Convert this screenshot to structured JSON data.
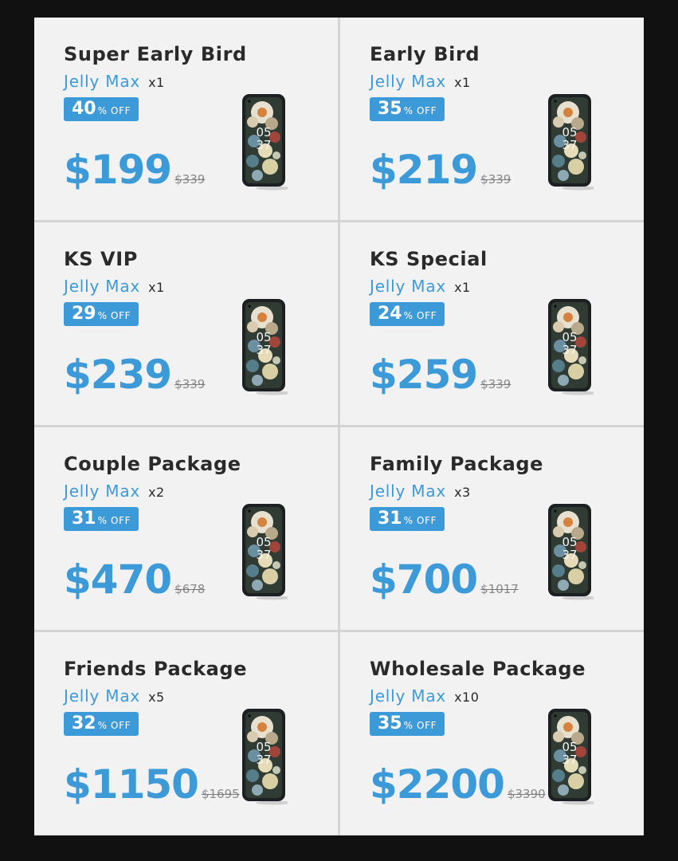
{
  "packages": [
    {
      "title": "Super Early Bird",
      "brand": "Jelly Max",
      "qty": "x1",
      "discount": "40",
      "off": "% OFF",
      "price": "$199",
      "original": "$339",
      "clock": "05 37"
    },
    {
      "title": "Early Bird",
      "brand": "Jelly Max",
      "qty": "x1",
      "discount": "35",
      "off": "% OFF",
      "price": "$219",
      "original": "$339",
      "clock": "05 37"
    },
    {
      "title": "KS VIP",
      "brand": "Jelly Max",
      "qty": "x1",
      "discount": "29",
      "off": "% OFF",
      "price": "$239",
      "original": "$339",
      "clock": "05 37"
    },
    {
      "title": "KS Special",
      "brand": "Jelly Max",
      "qty": "x1",
      "discount": "24",
      "off": "% OFF",
      "price": "$259",
      "original": "$339",
      "clock": "05 37"
    },
    {
      "title": "Couple Package",
      "brand": "Jelly Max",
      "qty": "x2",
      "discount": "31",
      "off": "% OFF",
      "price": "$470",
      "original": "$678",
      "clock": "05 37"
    },
    {
      "title": "Family Package",
      "brand": "Jelly Max",
      "qty": "x3",
      "discount": "31",
      "off": "% OFF",
      "price": "$700",
      "original": "$1017",
      "clock": "05 37"
    },
    {
      "title": "Friends Package",
      "brand": "Jelly Max",
      "qty": "x5",
      "discount": "32",
      "off": "% OFF",
      "price": "$1150",
      "original": "$1695",
      "clock": "05 37"
    },
    {
      "title": "Wholesale Package",
      "brand": "Jelly Max",
      "qty": "x10",
      "discount": "35",
      "off": "% OFF",
      "price": "$2200",
      "original": "$3390",
      "clock": "05 37"
    }
  ],
  "colors": {
    "accent": "#3d9ad8",
    "card": "#f2f2f2",
    "background": "#111111"
  },
  "icons": {
    "product_image": "phone-icon"
  }
}
